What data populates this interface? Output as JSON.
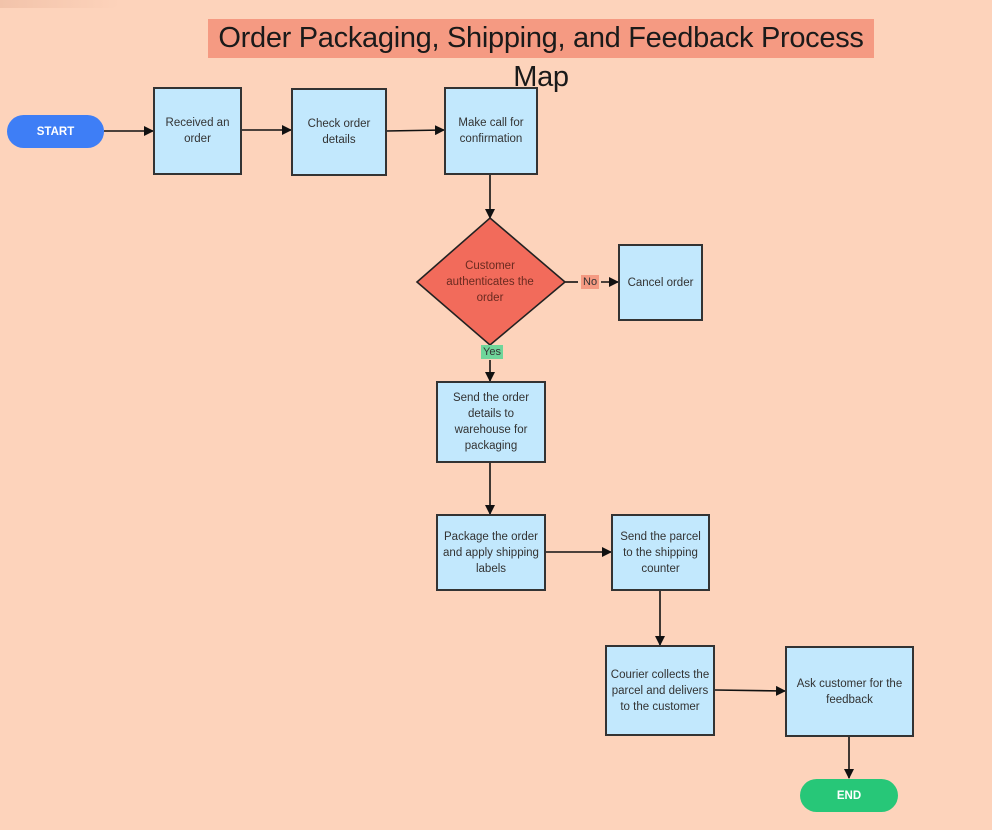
{
  "title": "Order Packaging, Shipping, and Feedback Process Map",
  "colors": {
    "background": "#fdd3bb",
    "title_bg": "#f59a82",
    "process_fill": "#c2e8fd",
    "decision_fill": "#f26b5b",
    "start_fill": "#3e7ef6",
    "end_fill": "#27c778",
    "yes_label_bg": "#6fd69a",
    "no_label_bg": "#f59a82"
  },
  "nodes": {
    "start": "START",
    "received": "Received an order",
    "check": "Check order details",
    "call": "Make call for confirmation",
    "decision": "Customer authenticates the order",
    "cancel": "Cancel order",
    "send_warehouse": "Send the order details to warehouse for packaging",
    "package": "Package the order and apply shipping labels",
    "send_parcel": "Send the parcel to the shipping counter",
    "courier": "Courier collects the parcel and delivers to the customer",
    "feedback": "Ask customer for the feedback",
    "end": "END"
  },
  "edge_labels": {
    "no": "No",
    "yes": "Yes"
  },
  "edges": [
    {
      "from": "start",
      "to": "received"
    },
    {
      "from": "received",
      "to": "check"
    },
    {
      "from": "check",
      "to": "call"
    },
    {
      "from": "call",
      "to": "decision"
    },
    {
      "from": "decision",
      "to": "cancel",
      "label": "No"
    },
    {
      "from": "decision",
      "to": "send_warehouse",
      "label": "Yes"
    },
    {
      "from": "send_warehouse",
      "to": "package"
    },
    {
      "from": "package",
      "to": "send_parcel"
    },
    {
      "from": "send_parcel",
      "to": "courier"
    },
    {
      "from": "courier",
      "to": "feedback"
    },
    {
      "from": "feedback",
      "to": "end"
    }
  ]
}
